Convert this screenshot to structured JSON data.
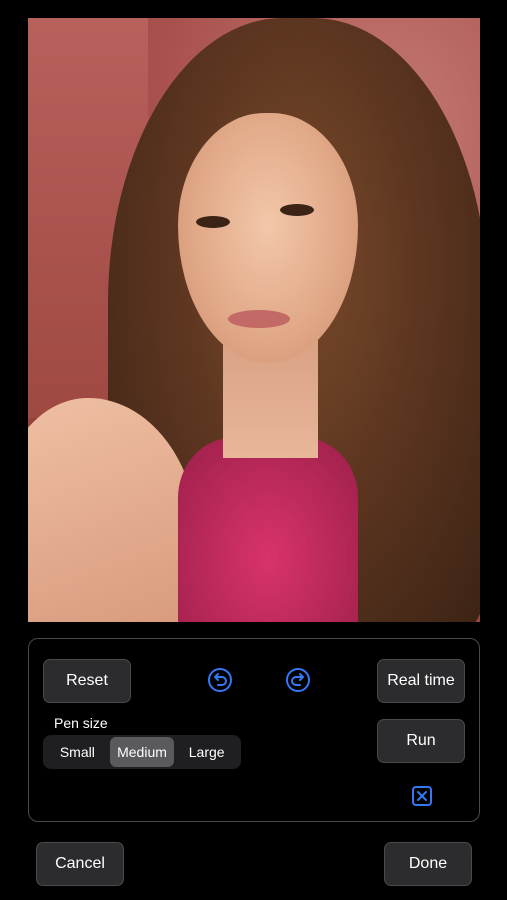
{
  "photo": {
    "description_icon": "portrait-photo"
  },
  "toolbar": {
    "reset_label": "Reset",
    "real_time_label": "Real time",
    "run_label": "Run",
    "undo_icon": "undo-icon",
    "redo_icon": "redo-icon",
    "clear_icon": "clear-mask-icon"
  },
  "pen_size": {
    "label": "Pen size",
    "options": [
      "Small",
      "Medium",
      "Large"
    ],
    "selected": "Medium"
  },
  "footer": {
    "cancel_label": "Cancel",
    "done_label": "Done"
  },
  "colors": {
    "accent": "#3478f6",
    "button_bg": "#2c2c2e",
    "segment_selected": "#5a5a5e"
  }
}
